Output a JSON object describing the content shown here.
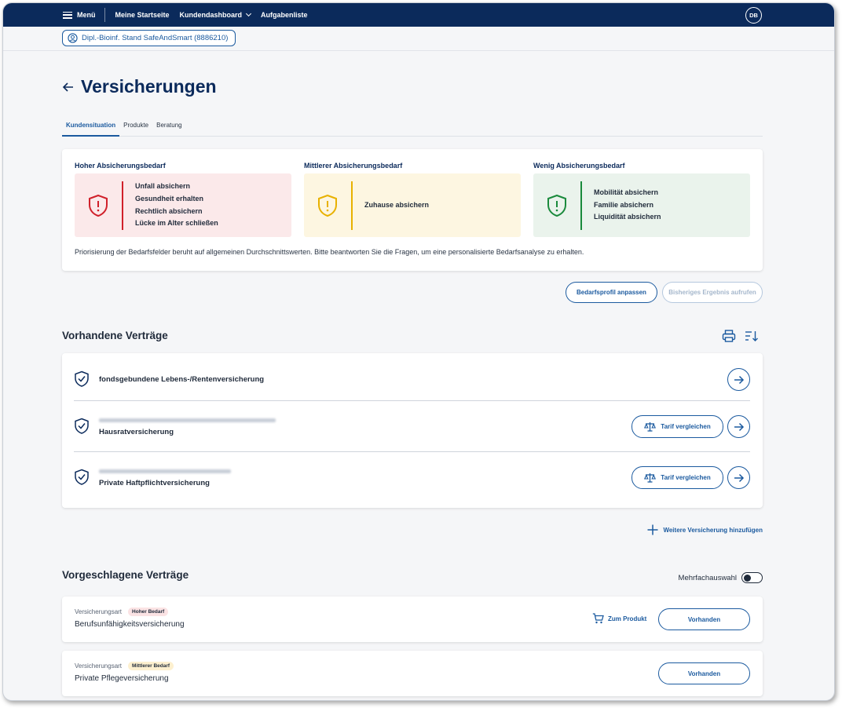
{
  "topbar": {
    "menu_label": "Menü",
    "nav": [
      "Meine Startseite",
      "Kundendashboard",
      "Aufgabenliste"
    ],
    "avatar_initials": "DB"
  },
  "customer": {
    "chip_label": "Dipl.-Bioinf. Stand SafeAndSmart (8886210)"
  },
  "page": {
    "title": "Versicherungen",
    "tabs": [
      {
        "label": "Kundensituation",
        "active": true
      },
      {
        "label": "Produkte",
        "active": false
      },
      {
        "label": "Beratung",
        "active": false
      }
    ]
  },
  "needs": {
    "high": {
      "heading": "Hoher Absicherungsbedarf",
      "items": [
        "Unfall absichern",
        "Gesundheit erhalten",
        "Rechtlich absichern",
        "Lücke im Alter schließen"
      ],
      "color": "#d0202a",
      "bg": "#fbe9ea"
    },
    "medium": {
      "heading": "Mittlerer Absicherungsbedarf",
      "items": [
        "Zuhause absichern"
      ],
      "color": "#e8b100",
      "bg": "#fdf6e1"
    },
    "low": {
      "heading": "Wenig Absicherungsbedarf",
      "items": [
        "Mobilität absichern",
        "Familie absichern",
        "Liquidität absichern"
      ],
      "color": "#1a8a3c",
      "bg": "#eaf3ec"
    },
    "note": "Priorisierung der Bedarfsfelder beruht auf allgemeinen Durchschnittswerten. Bitte beantworten Sie die Fragen, um eine personalisierte Bedarfsanalyse zu erhalten."
  },
  "actions": {
    "adjust_profile": "Bedarfsprofil anpassen",
    "previous_result": "Bisheriges Ergebnis aufrufen"
  },
  "existing": {
    "title": "Vorhandene Verträge",
    "contracts": [
      {
        "name": "fondsgebundene Lebens-/Rentenversicherung",
        "compare": false
      },
      {
        "name": "Hausratversicherung",
        "compare": true
      },
      {
        "name": "Private Haftpflichtversicherung",
        "compare": true
      }
    ],
    "compare_label": "Tarif vergleichen",
    "add_label": "Weitere Versicherung hinzufügen"
  },
  "suggested": {
    "title": "Vorgeschlagene Verträge",
    "toggle_label": "Mehrfachauswahl",
    "type_label": "Versicherungsart",
    "items": [
      {
        "badge": "Hoher Bedarf",
        "badge_bg": "#fbe3e4",
        "name": "Berufsunfähigkeitsversicherung",
        "product_link": "Zum Produkt",
        "action": "Vorhanden"
      },
      {
        "badge": "Mittlerer Bedarf",
        "badge_bg": "#fdf0cf",
        "name": "Private Pflegeversicherung",
        "action": "Vorhanden"
      }
    ]
  }
}
